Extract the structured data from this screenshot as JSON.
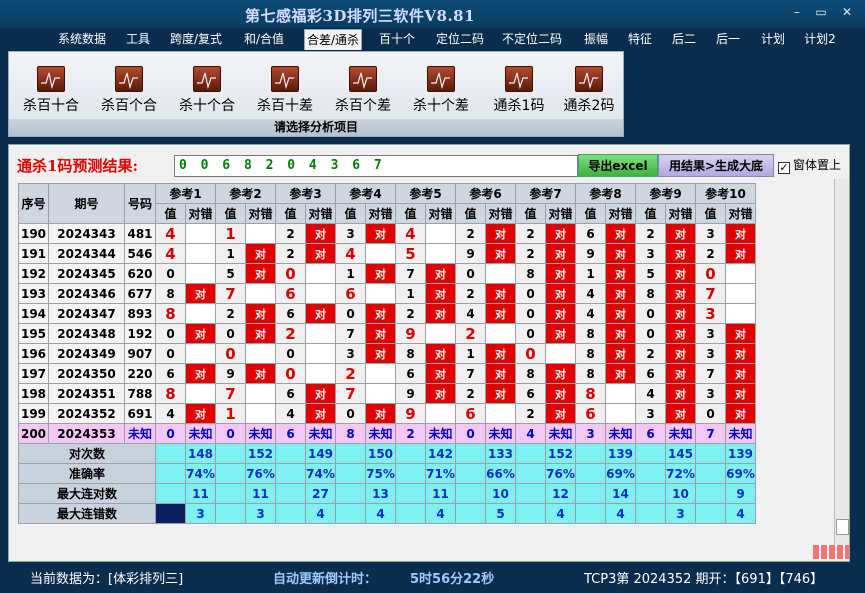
{
  "window": {
    "title": "第七感福彩3D排列三软件V8.81",
    "min": "–",
    "max": "▭",
    "close": "✕"
  },
  "menu": [
    "系统数据",
    "工具",
    "跨度/复式",
    "和/合值",
    "合差/通杀",
    "百十个",
    "定位二码",
    "不定位二码",
    "振幅",
    "特征",
    "后二",
    "后一",
    "计划",
    "计划2"
  ],
  "menu_active": "合差/通杀",
  "ribbon": {
    "tools": [
      "杀百十合",
      "杀百个合",
      "杀十个合",
      "杀百十差",
      "杀百个差",
      "杀十个差",
      "通杀1码",
      "通杀2码"
    ],
    "icon": "chart-icon",
    "caption": "请选择分析项目"
  },
  "result": {
    "label": "通杀1码预测结果:",
    "value": "0 0 6 8 2 0 4 3 6 7",
    "excel_button": "导出excel",
    "gen_button": "用结果>生成大底",
    "topmost_label": "窗体置上",
    "topmost_checked": true,
    "check_glyph": "✓"
  },
  "table": {
    "headers": {
      "seq": "序号",
      "period": "期号",
      "number": "号码",
      "value": "值",
      "correct": "对错"
    },
    "refs": [
      "参考1",
      "参考2",
      "参考3",
      "参考4",
      "参考5",
      "参考6",
      "参考7",
      "参考8",
      "参考9",
      "参考10"
    ],
    "hit_mark": "对",
    "rows": [
      {
        "seq": "190",
        "period": "2024343",
        "number": "481",
        "v": [
          "4",
          "1",
          "2",
          "3",
          "4",
          "2",
          "2",
          "6",
          "2",
          "3"
        ],
        "hit": [
          0,
          0,
          1,
          1,
          0,
          1,
          1,
          1,
          1,
          1
        ],
        "big": [
          1,
          1,
          0,
          0,
          1,
          0,
          0,
          0,
          0,
          0
        ]
      },
      {
        "seq": "191",
        "period": "2024344",
        "number": "546",
        "v": [
          "4",
          "1",
          "2",
          "4",
          "5",
          "9",
          "2",
          "9",
          "3",
          "2"
        ],
        "hit": [
          0,
          1,
          1,
          0,
          0,
          1,
          1,
          1,
          1,
          1
        ],
        "big": [
          1,
          0,
          0,
          1,
          1,
          0,
          0,
          0,
          0,
          0
        ]
      },
      {
        "seq": "192",
        "period": "2024345",
        "number": "620",
        "v": [
          "0",
          "5",
          "0",
          "1",
          "7",
          "0",
          "8",
          "1",
          "5",
          "0"
        ],
        "hit": [
          0,
          1,
          0,
          1,
          1,
          0,
          1,
          1,
          1,
          0
        ],
        "big": [
          0,
          0,
          1,
          0,
          0,
          0,
          0,
          0,
          0,
          1
        ]
      },
      {
        "seq": "193",
        "period": "2024346",
        "number": "677",
        "v": [
          "8",
          "7",
          "6",
          "6",
          "1",
          "2",
          "0",
          "4",
          "8",
          "7"
        ],
        "hit": [
          1,
          0,
          0,
          0,
          1,
          1,
          1,
          1,
          1,
          0
        ],
        "big": [
          0,
          1,
          1,
          1,
          0,
          0,
          0,
          0,
          0,
          1
        ]
      },
      {
        "seq": "194",
        "period": "2024347",
        "number": "893",
        "v": [
          "8",
          "2",
          "6",
          "0",
          "2",
          "4",
          "0",
          "4",
          "0",
          "3"
        ],
        "hit": [
          0,
          1,
          1,
          1,
          1,
          1,
          1,
          1,
          1,
          0
        ],
        "big": [
          1,
          0,
          0,
          0,
          0,
          0,
          0,
          0,
          0,
          1
        ]
      },
      {
        "seq": "195",
        "period": "2024348",
        "number": "192",
        "v": [
          "0",
          "0",
          "2",
          "7",
          "9",
          "2",
          "0",
          "8",
          "0",
          "3"
        ],
        "hit": [
          1,
          1,
          0,
          1,
          0,
          0,
          1,
          1,
          1,
          1
        ],
        "big": [
          0,
          0,
          1,
          0,
          1,
          1,
          0,
          0,
          0,
          0
        ]
      },
      {
        "seq": "196",
        "period": "2024349",
        "number": "907",
        "v": [
          "0",
          "0",
          "0",
          "3",
          "8",
          "1",
          "0",
          "8",
          "2",
          "3"
        ],
        "hit": [
          0,
          0,
          0,
          1,
          1,
          1,
          0,
          1,
          1,
          1
        ],
        "big": [
          0,
          1,
          0,
          0,
          0,
          0,
          1,
          0,
          0,
          0
        ]
      },
      {
        "seq": "197",
        "period": "2024350",
        "number": "220",
        "v": [
          "6",
          "9",
          "0",
          "2",
          "6",
          "7",
          "8",
          "8",
          "6",
          "7"
        ],
        "hit": [
          1,
          1,
          0,
          0,
          1,
          1,
          1,
          1,
          1,
          1
        ],
        "big": [
          0,
          0,
          1,
          1,
          0,
          0,
          0,
          0,
          0,
          0
        ]
      },
      {
        "seq": "198",
        "period": "2024351",
        "number": "788",
        "v": [
          "8",
          "7",
          "6",
          "7",
          "9",
          "2",
          "6",
          "8",
          "4",
          "3"
        ],
        "hit": [
          0,
          0,
          1,
          0,
          1,
          1,
          1,
          0,
          1,
          1
        ],
        "big": [
          1,
          1,
          0,
          1,
          0,
          0,
          0,
          1,
          0,
          0
        ]
      },
      {
        "seq": "199",
        "period": "2024352",
        "number": "691",
        "v": [
          "4",
          "1",
          "4",
          "0",
          "9",
          "6",
          "2",
          "6",
          "3",
          "0"
        ],
        "hit": [
          1,
          0,
          1,
          1,
          0,
          0,
          1,
          0,
          1,
          1
        ],
        "big": [
          0,
          1,
          0,
          0,
          1,
          1,
          0,
          1,
          0,
          0
        ]
      }
    ],
    "predict": {
      "seq": "200",
      "period": "2024353",
      "number": "未知",
      "v": [
        "0",
        "0",
        "6",
        "8",
        "2",
        "0",
        "4",
        "3",
        "6",
        "7"
      ],
      "unknown": "未知"
    },
    "stats": [
      {
        "label": "对次数",
        "values": [
          "148",
          "152",
          "149",
          "150",
          "142",
          "133",
          "152",
          "139",
          "145",
          "139"
        ]
      },
      {
        "label": "准确率",
        "values": [
          "74%",
          "76%",
          "74%",
          "75%",
          "71%",
          "66%",
          "76%",
          "69%",
          "72%",
          "69%"
        ]
      },
      {
        "label": "最大连对数",
        "values": [
          "11",
          "11",
          "27",
          "13",
          "11",
          "10",
          "12",
          "14",
          "10",
          "9"
        ]
      },
      {
        "label": "最大连错数",
        "values": [
          "3",
          "3",
          "4",
          "4",
          "4",
          "5",
          "4",
          "4",
          "3",
          "4"
        ]
      }
    ]
  },
  "status": {
    "current_data": "当前数据为：[体彩排列三]",
    "countdown_label": "自动更新倒计时：",
    "countdown": "5时56分22秒",
    "draw_info": "TCP3第 2024352 期开：【691】【746】"
  },
  "colors": {
    "hit": "#e00000",
    "predict_row": "#f4c8f4",
    "stats": "#7ff0f0",
    "accent_title": "#d8dcff"
  }
}
